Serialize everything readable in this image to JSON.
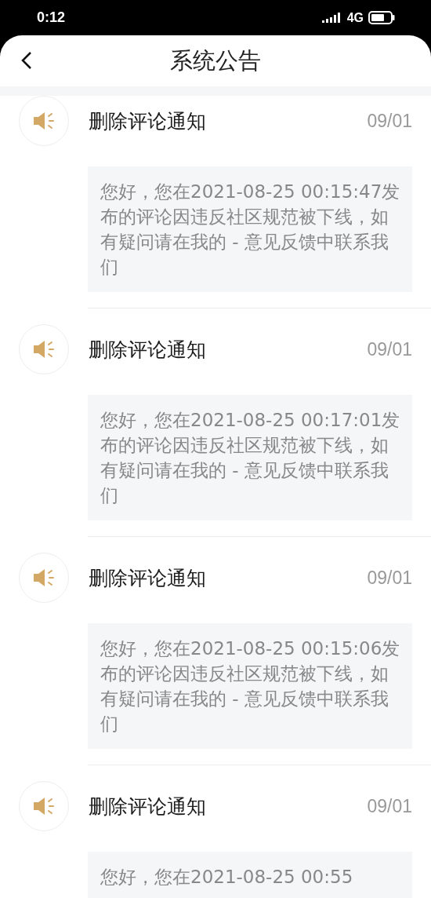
{
  "status_bar": {
    "time": "0:12",
    "network": "4G"
  },
  "header": {
    "title": "系统公告"
  },
  "notices": [
    {
      "title": "删除评论通知",
      "date": "09/01",
      "message": "您好，您在2021-08-25 00:15:47发布的评论因违反社区规范被下线，如有疑问请在我的 - 意见反馈中联系我们"
    },
    {
      "title": "删除评论通知",
      "date": "09/01",
      "message": "您好，您在2021-08-25 00:17:01发布的评论因违反社区规范被下线，如有疑问请在我的 - 意见反馈中联系我们"
    },
    {
      "title": "删除评论通知",
      "date": "09/01",
      "message": "您好，您在2021-08-25 00:15:06发布的评论因违反社区规范被下线，如有疑问请在我的 - 意见反馈中联系我们"
    },
    {
      "title": "删除评论通知",
      "date": "09/01",
      "message": "您好，您在2021-08-25 00:55"
    }
  ]
}
